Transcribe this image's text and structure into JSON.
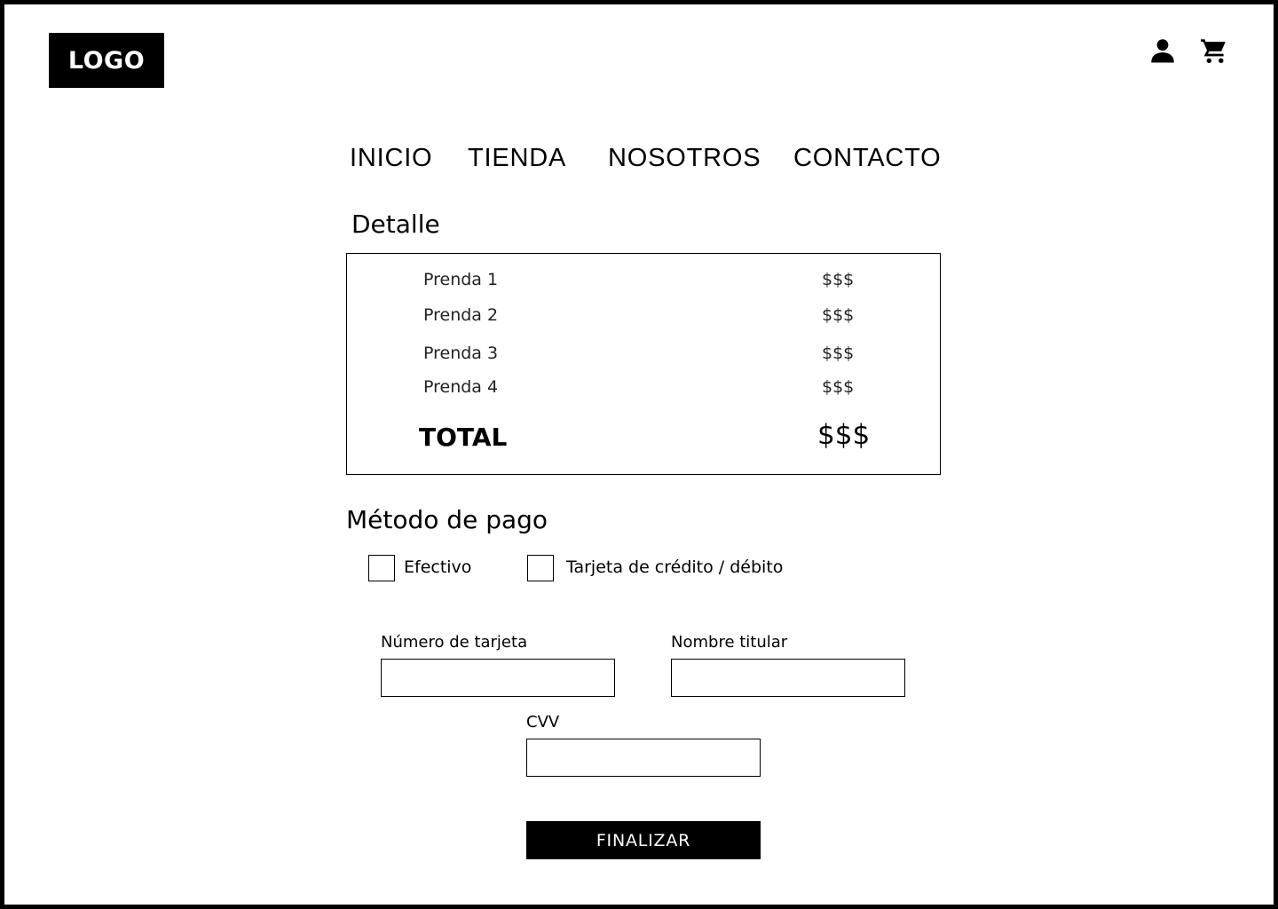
{
  "header": {
    "logo_text": "LOGO",
    "icons": [
      "user-icon",
      "cart-icon"
    ]
  },
  "nav": {
    "items": [
      {
        "label": "INICIO"
      },
      {
        "label": "TIENDA"
      },
      {
        "label": "NOSOTROS"
      },
      {
        "label": "CONTACTO"
      }
    ]
  },
  "detail": {
    "title": "Detalle",
    "items": [
      {
        "name": "Prenda 1",
        "price": "$$$"
      },
      {
        "name": "Prenda 2",
        "price": "$$$"
      },
      {
        "name": "Prenda 3",
        "price": "$$$"
      },
      {
        "name": "Prenda 4",
        "price": "$$$"
      }
    ],
    "total_label": "TOTAL",
    "total_price": "$$$"
  },
  "payment": {
    "title": "Método de pago",
    "options": [
      {
        "label": "Efectivo",
        "checked": false
      },
      {
        "label": "Tarjeta de crédito / débito",
        "checked": false
      }
    ],
    "fields": {
      "card_number": {
        "label": "Número de tarjeta",
        "value": "",
        "placeholder": ""
      },
      "holder_name": {
        "label": "Nombre titular",
        "value": "",
        "placeholder": ""
      },
      "cvv": {
        "label": "CVV",
        "value": "",
        "placeholder": ""
      }
    },
    "submit_label": "FINALIZAR"
  },
  "colors": {
    "primary": "#000000",
    "background": "#ffffff"
  }
}
